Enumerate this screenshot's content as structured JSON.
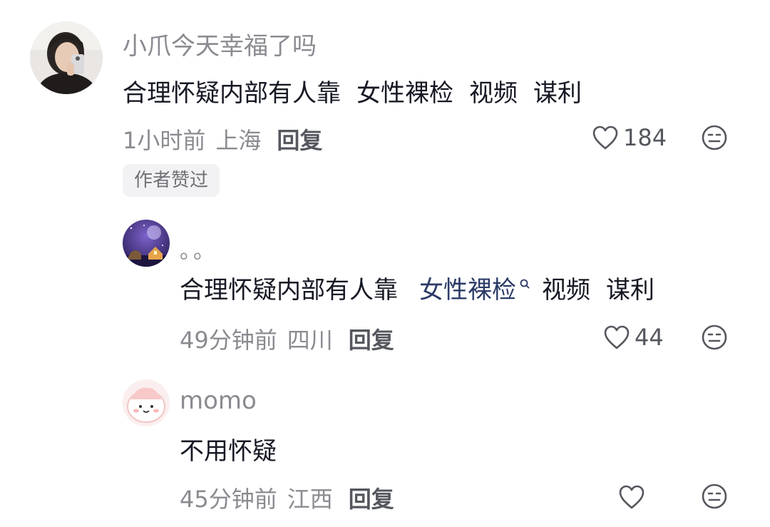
{
  "comments": [
    {
      "username": "小爪今天幸福了吗",
      "content": [
        "合理怀疑内部有人靠",
        "女性裸检",
        "视频",
        "谋利"
      ],
      "time": "1小时前",
      "location": "上海",
      "reply_label": "回复",
      "likes": "184",
      "badge": "作者赞过"
    },
    {
      "username": "。。",
      "content": [
        "合理怀疑内部有人靠",
        "女性裸检",
        "视频",
        "谋利"
      ],
      "keyword": "女性裸检",
      "time": "49分钟前",
      "location": "四川",
      "reply_label": "回复",
      "likes": "44"
    },
    {
      "username": "momo",
      "content": [
        "不用怀疑"
      ],
      "time": "45分钟前",
      "location": "江西",
      "reply_label": "回复",
      "likes": ""
    }
  ],
  "icons": {
    "like": "heart-outline-icon",
    "dislike": "neutral-face-icon",
    "search": "search-icon"
  },
  "colors": {
    "username": "#8a8b91",
    "content": "#161823",
    "keyword": "#2b3a67",
    "badge_bg": "#f2f2f4"
  }
}
